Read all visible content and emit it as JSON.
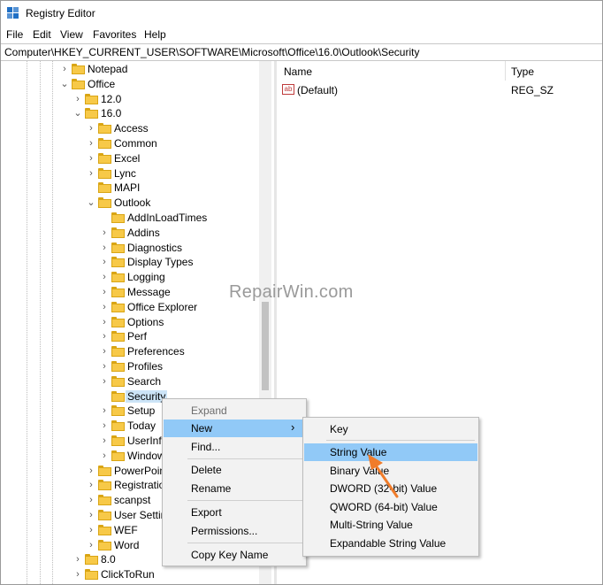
{
  "window": {
    "title": "Registry Editor"
  },
  "menu": [
    "File",
    "Edit",
    "View",
    "Favorites",
    "Help"
  ],
  "address": "Computer\\HKEY_CURRENT_USER\\SOFTWARE\\Microsoft\\Office\\16.0\\Outlook\\Security",
  "tree": [
    {
      "label": "Notepad",
      "chev": "right"
    },
    {
      "label": "Office",
      "chev": "down"
    },
    {
      "label": "12.0",
      "chev": "right"
    },
    {
      "label": "16.0",
      "chev": "down"
    },
    {
      "label": "Access",
      "chev": "right"
    },
    {
      "label": "Common",
      "chev": "right"
    },
    {
      "label": "Excel",
      "chev": "right"
    },
    {
      "label": "Lync",
      "chev": "right"
    },
    {
      "label": "MAPI",
      "chev": "none"
    },
    {
      "label": "Outlook",
      "chev": "down"
    },
    {
      "label": "AddInLoadTimes",
      "chev": "none"
    },
    {
      "label": "Addins",
      "chev": "right"
    },
    {
      "label": "Diagnostics",
      "chev": "right"
    },
    {
      "label": "Display Types",
      "chev": "right"
    },
    {
      "label": "Logging",
      "chev": "right"
    },
    {
      "label": "Message",
      "chev": "right"
    },
    {
      "label": "Office Explorer",
      "chev": "right"
    },
    {
      "label": "Options",
      "chev": "right"
    },
    {
      "label": "Perf",
      "chev": "right"
    },
    {
      "label": "Preferences",
      "chev": "right"
    },
    {
      "label": "Profiles",
      "chev": "right"
    },
    {
      "label": "Search",
      "chev": "right"
    },
    {
      "label": "Security",
      "chev": "none"
    },
    {
      "label": "Setup",
      "chev": "right"
    },
    {
      "label": "Today",
      "chev": "right"
    },
    {
      "label": "UserInfo",
      "chev": "right"
    },
    {
      "label": "Window",
      "chev": "right"
    },
    {
      "label": "PowerPoint",
      "chev": "right"
    },
    {
      "label": "Registration",
      "chev": "right"
    },
    {
      "label": "scanpst",
      "chev": "right"
    },
    {
      "label": "User Settings",
      "chev": "right"
    },
    {
      "label": "WEF",
      "chev": "right"
    },
    {
      "label": "Word",
      "chev": "right"
    },
    {
      "label": "8.0",
      "chev": "right"
    },
    {
      "label": "ClickToRun",
      "chev": "right"
    }
  ],
  "list": {
    "col_name": "Name",
    "col_type": "Type",
    "rows": [
      {
        "name": "(Default)",
        "type": "REG_SZ",
        "icon": "ab-icon"
      }
    ]
  },
  "watermark": "RepairWin.com",
  "context_menu": {
    "expand": "Expand",
    "new": "New",
    "find": "Find...",
    "delete": "Delete",
    "rename": "Rename",
    "export": "Export",
    "permissions": "Permissions...",
    "copy_key_name": "Copy Key Name"
  },
  "submenu": [
    "Key",
    "String Value",
    "Binary Value",
    "DWORD (32-bit) Value",
    "QWORD (64-bit) Value",
    "Multi-String Value",
    "Expandable String Value"
  ],
  "colors": {
    "highlight": "#91c9f7",
    "selection": "#cce4f7",
    "folder": "#f7c948",
    "arrow": "#f07c2a",
    "icon_blue": "#1f6fc5"
  }
}
